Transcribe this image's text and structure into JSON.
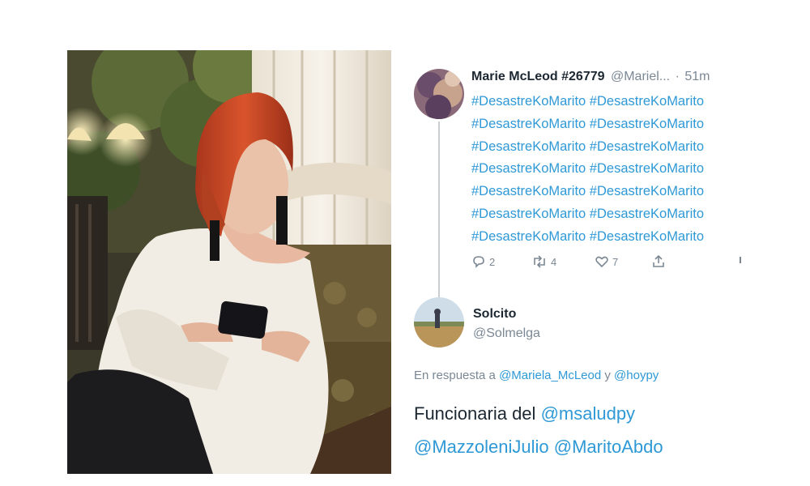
{
  "tweet1": {
    "author_name": "Marie McLeod #26779",
    "author_handle": "@Mariel...",
    "separator": "·",
    "time": "51m",
    "hashtag_lines": [
      "#DesastreKoMarito #DesastreKoMarito",
      "#DesastreKoMarito #DesastreKoMarito",
      "#DesastreKoMarito #DesastreKoMarito",
      "#DesastreKoMarito #DesastreKoMarito",
      "#DesastreKoMarito #DesastreKoMarito",
      "#DesastreKoMarito #DesastreKoMarito",
      "#DesastreKoMarito #DesastreKoMarito"
    ],
    "reply_count": "2",
    "retweet_count": "4",
    "like_count": "7"
  },
  "tweet2": {
    "author_name": "Solcito",
    "author_handle": "@Solmelga",
    "reply_prefix": "En respuesta a",
    "reply_mention_1": "@Mariela_McLeod",
    "reply_and": "y",
    "reply_mention_2": "@hoypy",
    "body_text": "Funcionaria del",
    "body_mention_1": "@msaludpy",
    "body_mention_2": "@MazzoleniJulio",
    "body_mention_3": "@MaritoAbdo"
  },
  "colors": {
    "link_blue": "#2e99d6",
    "text_dark": "#1c2731",
    "text_grey": "#7b8894",
    "thread_line": "#c9ced3"
  },
  "icons": [
    "reply-icon",
    "retweet-icon",
    "like-icon",
    "share-icon",
    "more-icon"
  ]
}
